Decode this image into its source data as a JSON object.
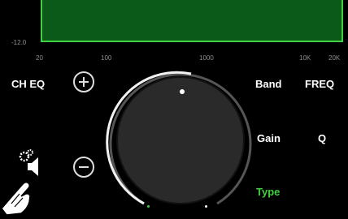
{
  "graph": {
    "db_label": "-12.0",
    "freq_ticks": [
      "20",
      "100",
      "1000",
      "10K",
      "20K"
    ]
  },
  "controls": {
    "ch_eq_label": "CH EQ",
    "band_label": "Band",
    "freq_label": "FREQ",
    "gain_label": "Gain",
    "q_label": "Q",
    "type_label": "Type"
  },
  "colors": {
    "accent_green": "#3fd13f",
    "graph_fill": "#0b5a1a"
  },
  "icons": {
    "zoom_in": "plus-circle-icon",
    "zoom_out": "minus-circle-icon",
    "settings": "gear-speaker-icon",
    "hand": "pointing-hand-icon"
  }
}
